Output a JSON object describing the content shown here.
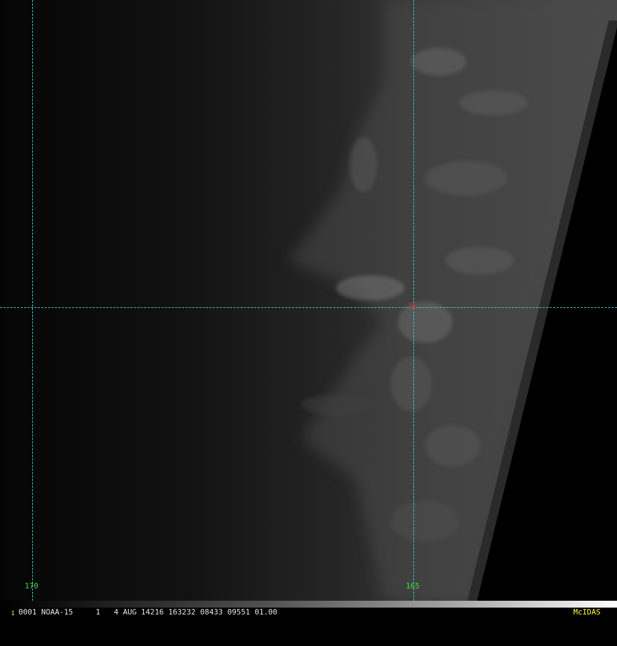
{
  "image": {
    "lon_labels": [
      "170",
      "165"
    ],
    "lat_label": "10",
    "grid_color": "#2fd6d6",
    "lon_label_color": "#3ee03e",
    "lat_label_color": "#e02828"
  },
  "infobar": {
    "frame_number": "1",
    "text": "0001 NOAA-15     1   4 AUG 14216 163232 08433 09551 01.00",
    "brand": "McIDAS",
    "brand_color": "#ffff3a"
  }
}
